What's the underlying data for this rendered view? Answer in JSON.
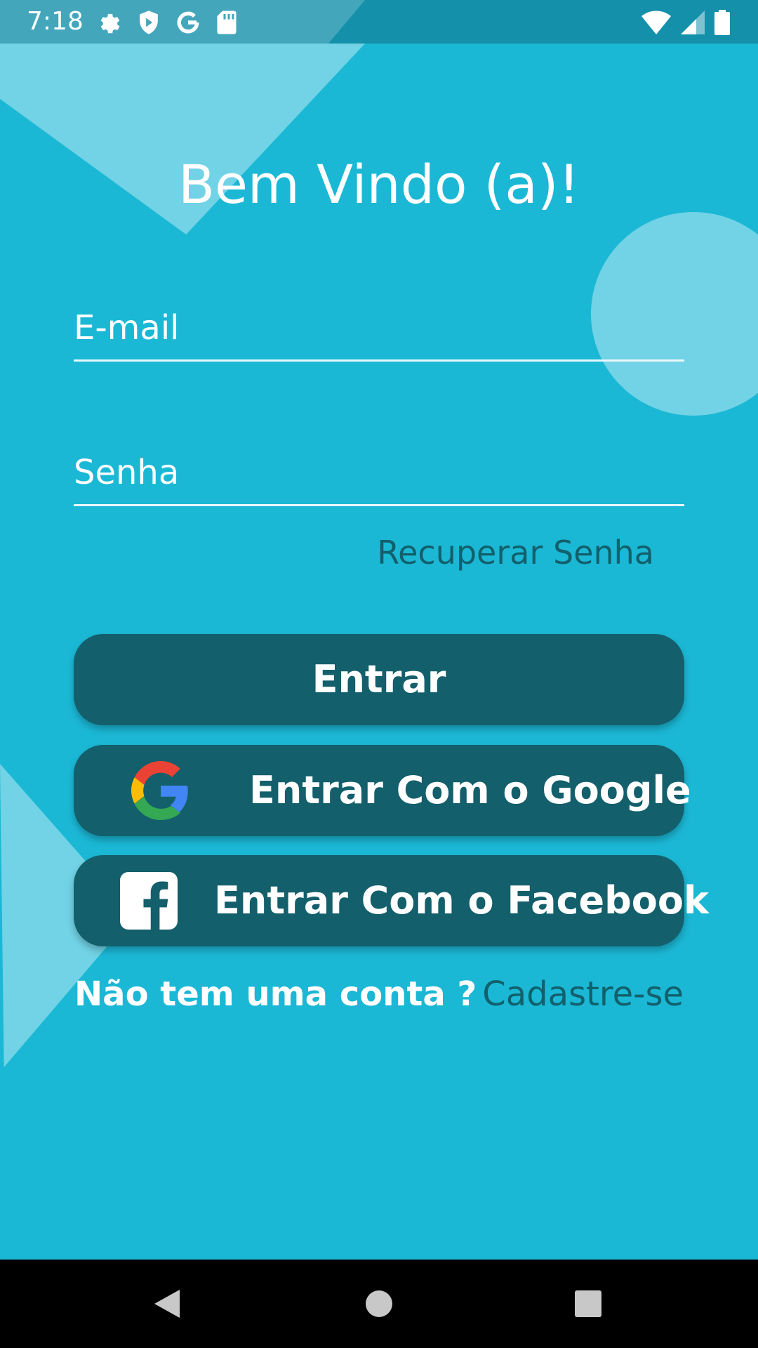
{
  "status_bar": {
    "time": "7:18",
    "icons_left": [
      "settings-icon",
      "shield-icon",
      "google-g-icon",
      "sd-card-icon"
    ],
    "icons_right": [
      "wifi-icon",
      "signal-icon",
      "battery-icon"
    ]
  },
  "login": {
    "title": "Bem Vindo (a)!",
    "email_placeholder": "E-mail",
    "email_value": "",
    "password_placeholder": "Senha",
    "password_value": "",
    "recover_label": "Recuperar Senha",
    "enter_label": "Entrar",
    "google_label": "Entrar Com o Google",
    "facebook_label": "Entrar Com o Facebook",
    "no_account_text": "Não tem uma conta ?",
    "signup_label": "Cadastre-se"
  },
  "nav_bar": {
    "buttons": [
      "back-icon",
      "home-icon",
      "recents-icon"
    ]
  },
  "colors": {
    "background": "#1bb8d6",
    "button": "#135f6b",
    "link": "#11606b",
    "status_bar": "#1590aa",
    "facebook_icon": "#135f6b"
  }
}
